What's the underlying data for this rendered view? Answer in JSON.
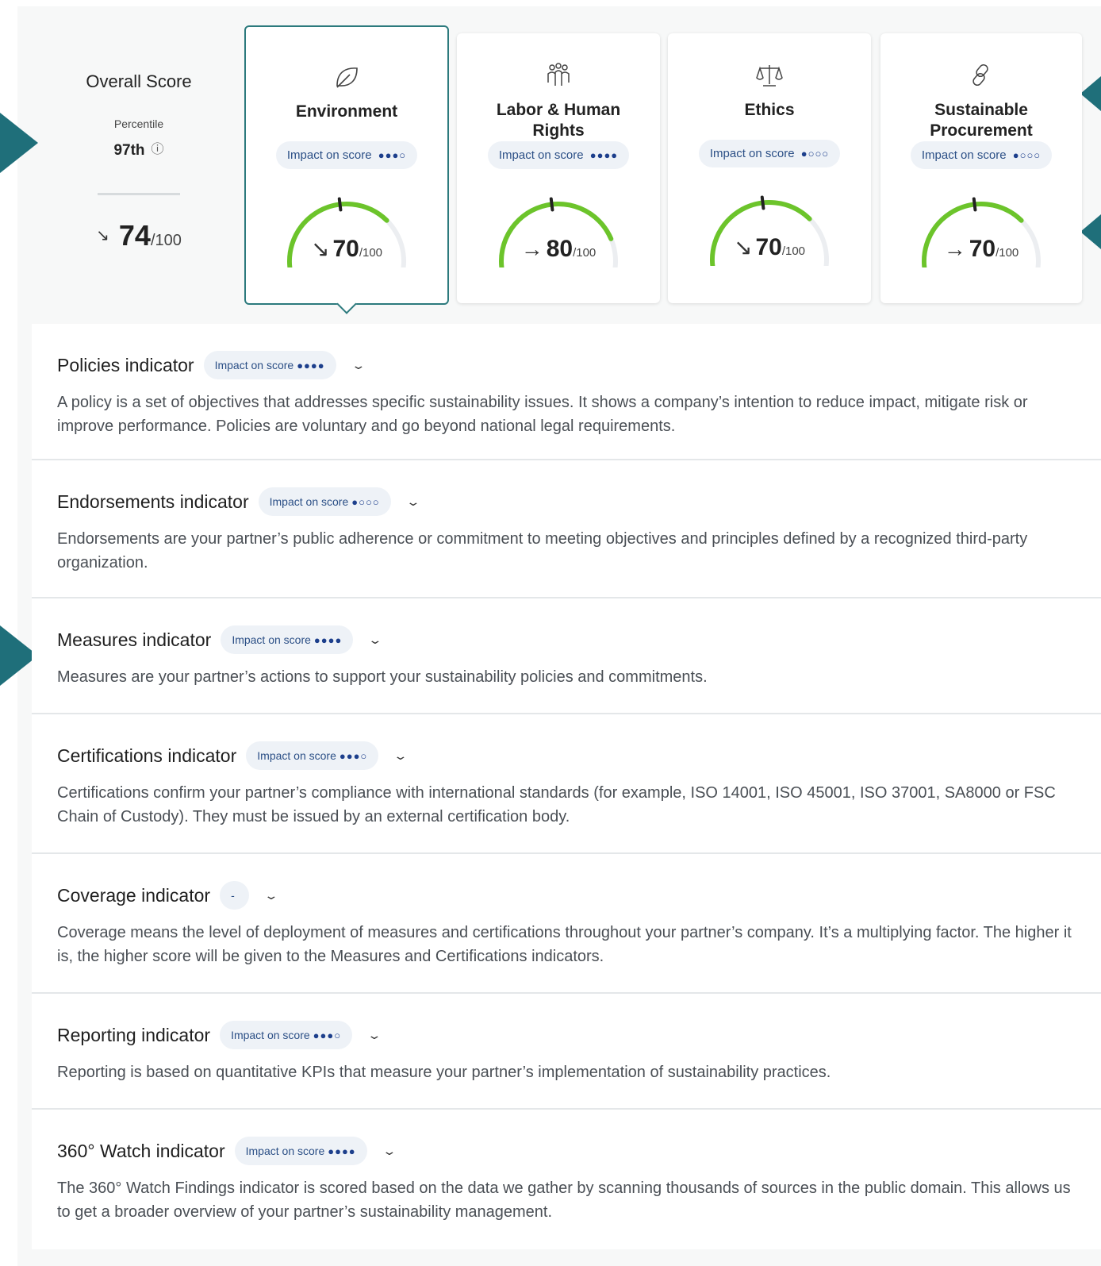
{
  "overall": {
    "title": "Overall Score",
    "percentile_label": "Percentile",
    "percentile_value": "97th",
    "score": "74",
    "score_denominator": "/100",
    "trend": "↘"
  },
  "categories": [
    {
      "title": "Environment",
      "impact_label": "Impact on score",
      "impact_dots": "●●●○",
      "impact_level": 3,
      "score": "70",
      "score_value": 70,
      "trend": "↘",
      "denominator": "/100",
      "selected": true,
      "icon": "leaf-icon"
    },
    {
      "title": "Labor & Human Rights",
      "impact_label": "Impact on score",
      "impact_dots": "●●●●",
      "impact_level": 4,
      "score": "80",
      "score_value": 80,
      "trend": "→",
      "denominator": "/100",
      "selected": false,
      "icon": "people-icon"
    },
    {
      "title": "Ethics",
      "impact_label": "Impact on score",
      "impact_dots": "●○○○",
      "impact_level": 1,
      "score": "70",
      "score_value": 70,
      "trend": "↘",
      "denominator": "/100",
      "selected": false,
      "icon": "scales-icon"
    },
    {
      "title": "Sustainable Procurement",
      "impact_label": "Impact on score",
      "impact_dots": "●○○○",
      "impact_level": 1,
      "score": "70",
      "score_value": 70,
      "trend": "→",
      "denominator": "/100",
      "selected": false,
      "icon": "chain-link-icon"
    }
  ],
  "indicators": [
    {
      "name": "Policies indicator",
      "impact_label": "Impact on score",
      "impact_dots": "●●●●",
      "description": "A policy is a set of objectives that addresses specific sustainability issues. It shows a company’s intention to reduce impact, mitigate risk or improve performance. Policies are voluntary and go beyond national legal requirements."
    },
    {
      "name": "Endorsements indicator",
      "impact_label": "Impact on score",
      "impact_dots": "●○○○",
      "description": "Endorsements are your partner’s public adherence or commitment to meeting objectives and principles defined by a recognized third-party organization."
    },
    {
      "name": "Measures indicator",
      "impact_label": "Impact on score",
      "impact_dots": "●●●●",
      "description": "Measures are your partner’s actions to support your sustainability policies and commitments."
    },
    {
      "name": "Certifications indicator",
      "impact_label": "Impact on score",
      "impact_dots": "●●●○",
      "description": "Certifications confirm your partner’s compliance with international standards (for example, ISO 14001, ISO 45001, ISO 37001, SA8000 or FSC Chain of Custody). They must be issued by an external certification body."
    },
    {
      "name": "Coverage indicator",
      "impact_label": "-",
      "impact_dots": "",
      "description": "Coverage means the level of deployment of measures and certifications throughout your partner’s company. It’s a multiplying factor. The higher it is, the higher score will be given to the Measures and Certifications indicators."
    },
    {
      "name": "Reporting indicator",
      "impact_label": "Impact on score",
      "impact_dots": "●●●○",
      "description": "Reporting is based on quantitative KPIs that measure your partner’s implementation of sustainability practices."
    },
    {
      "name": "360° Watch indicator",
      "impact_label": "Impact on score",
      "impact_dots": "●●●●",
      "description": "The 360° Watch Findings indicator is scored based on the data we gather by scanning thousands of sources in the public domain. This allows us to get a broader overview of your partner’s sustainability management."
    }
  ],
  "colors": {
    "accent": "#1f6f7a",
    "selected_border": "#2c7a7d",
    "gauge_fill": "#6cc42b",
    "gauge_track": "#eceef1",
    "impact_dots": "#1d3f8c"
  }
}
